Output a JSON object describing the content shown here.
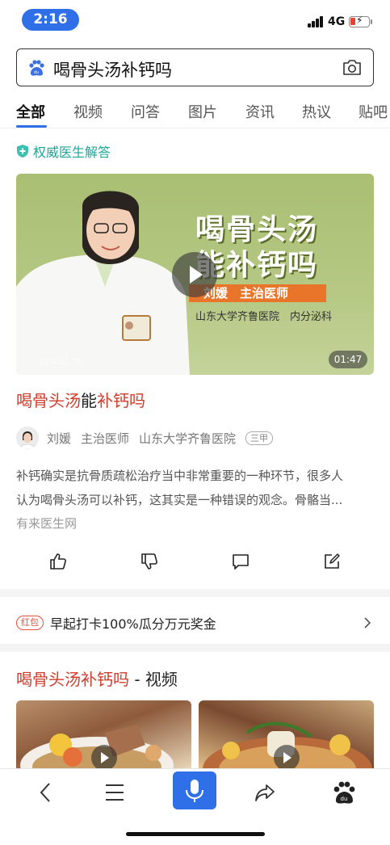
{
  "status_bar": {
    "time": "2:16",
    "network": "4G"
  },
  "search": {
    "query": "喝骨头汤补钙吗"
  },
  "tabs": [
    {
      "label": "全部"
    },
    {
      "label": "视频"
    },
    {
      "label": "问答"
    },
    {
      "label": "图片"
    },
    {
      "label": "资讯"
    },
    {
      "label": "热议"
    },
    {
      "label": "贴吧"
    }
  ],
  "authority_tag": "权威医生解答",
  "video": {
    "title_line1": "喝骨头汤",
    "title_line2": "能补钙吗",
    "doctor_bar": "刘媛　主治医师",
    "hospital": "山东大学齐鲁医院　内分泌科",
    "duration": "01:47",
    "watermark": "youlai.cn"
  },
  "result": {
    "title_part1": "喝骨头汤",
    "title_part2": "能",
    "title_part3": "补钙吗",
    "doctor_name": "刘媛",
    "doctor_title": "主治医师",
    "hospital": "山东大学齐鲁医院",
    "hospital_tier": "三甲",
    "snippet_line1": "补钙确实是抗骨质疏松治疗当中非常重要的一种环节，很多人",
    "snippet_line2": "认为喝骨头汤可以补钙，这其实是一种错误的观念。骨骼当...",
    "source": "有来医生网"
  },
  "promo": {
    "badge": "红包",
    "text": "早起打卡100%瓜分万元奖金"
  },
  "video_section": {
    "title_highlight": "喝骨头汤补钙吗",
    "title_suffix": " - 视频"
  },
  "colors": {
    "accent": "#2f6fe8",
    "highlight": "#d23a2a",
    "teal": "#1aa59b"
  }
}
